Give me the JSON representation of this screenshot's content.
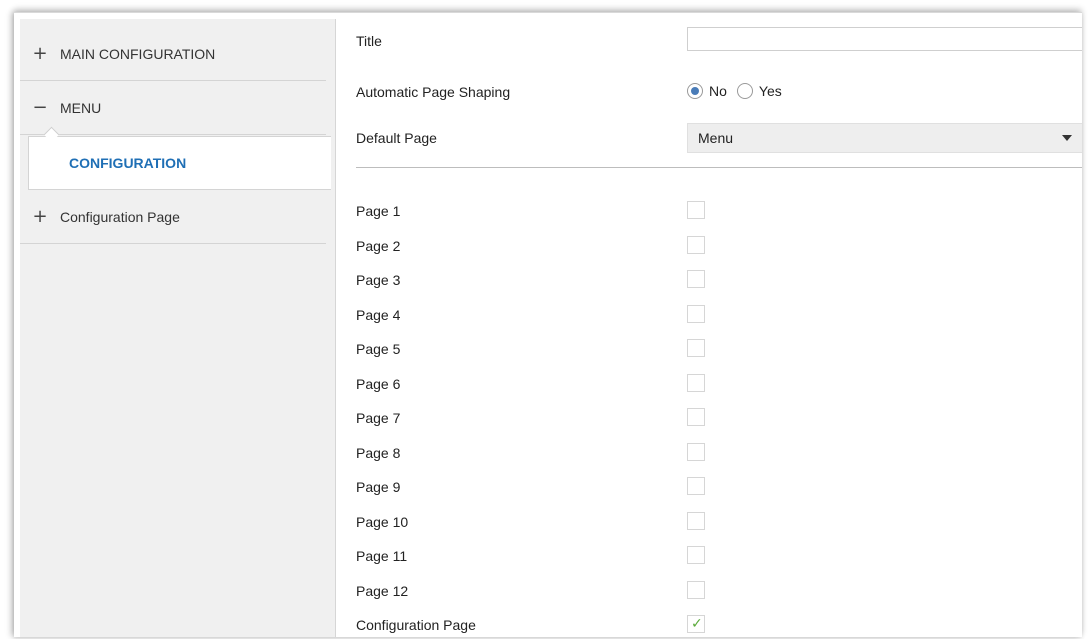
{
  "sidebar": {
    "items": [
      {
        "sign": "+",
        "label": "MAIN CONFIGURATION"
      },
      {
        "sign": "−",
        "label": "MENU"
      },
      {
        "sign": "",
        "label": "CONFIGURATION"
      },
      {
        "sign": "+",
        "label": "Configuration Page"
      }
    ]
  },
  "main": {
    "title_label": "Title",
    "title_value": "",
    "auto_shaping_label": "Automatic Page Shaping",
    "auto_shaping_options": [
      "No",
      "Yes"
    ],
    "auto_shaping_selected": "No",
    "default_page_label": "Default Page",
    "default_page_value": "Menu",
    "pages": [
      {
        "label": "Page 1",
        "checked": false
      },
      {
        "label": "Page 2",
        "checked": false
      },
      {
        "label": "Page 3",
        "checked": false
      },
      {
        "label": "Page 4",
        "checked": false
      },
      {
        "label": "Page 5",
        "checked": false
      },
      {
        "label": "Page 6",
        "checked": false
      },
      {
        "label": "Page 7",
        "checked": false
      },
      {
        "label": "Page 8",
        "checked": false
      },
      {
        "label": "Page 9",
        "checked": false
      },
      {
        "label": "Page 10",
        "checked": false
      },
      {
        "label": "Page 11",
        "checked": false
      },
      {
        "label": "Page 12",
        "checked": false
      },
      {
        "label": "Configuration Page",
        "checked": true
      }
    ],
    "check_glyph": "✓"
  },
  "colors": {
    "selected_text": "#1f6fb5",
    "radio_dot": "#4a7cb8",
    "check": "#5aaa3a",
    "sidebar_bg": "#f0f0f0"
  }
}
